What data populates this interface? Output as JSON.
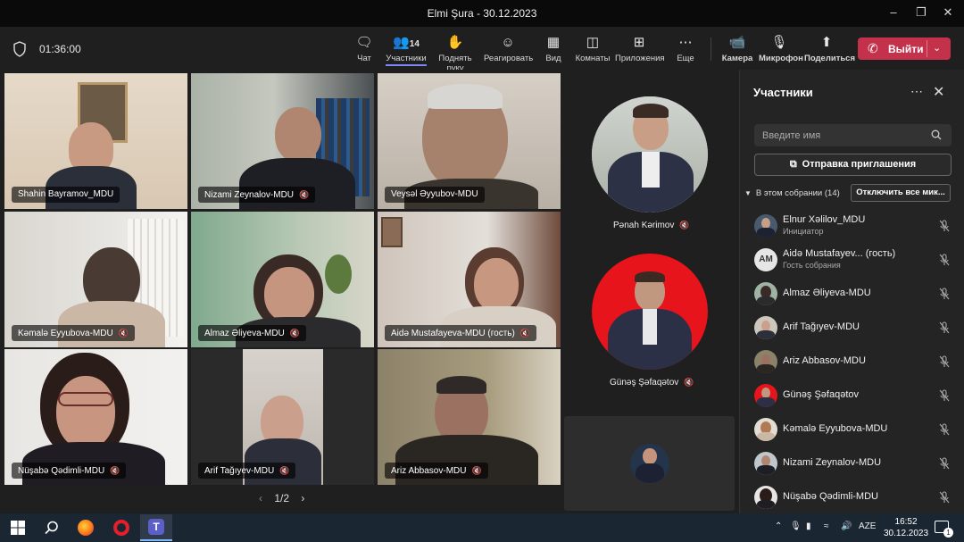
{
  "window": {
    "title": "Elmi Şura - 30.12.2023"
  },
  "meeting": {
    "timer": "01:36:00"
  },
  "toolbar": {
    "chat": "Чат",
    "participants": "Участники",
    "participants_count": "14",
    "raise_hand": "Поднять руку",
    "react": "Реагировать",
    "view": "Вид",
    "rooms": "Комнаты",
    "apps": "Приложения",
    "more": "Еще",
    "camera": "Камера",
    "mic": "Микрофон",
    "share": "Поделиться",
    "leave": "Выйти"
  },
  "grid": {
    "tiles": [
      {
        "name": "Shahin Bayramov_MDU",
        "muted": false
      },
      {
        "name": "Nizami Zeynalov-MDU",
        "muted": true
      },
      {
        "name": "Veysəl Əyyubov-MDU",
        "muted": false
      },
      {
        "name": "Kəmalə Eyyubova-MDU",
        "muted": true
      },
      {
        "name": "Almaz Əliyeva-MDU",
        "muted": true
      },
      {
        "name": "Aidə Mustafayeva-MDU (гость)",
        "muted": true
      },
      {
        "name": "Nüşabə Qədimli-MDU",
        "muted": true
      },
      {
        "name": "Arif Tağıyev-MDU",
        "muted": true
      },
      {
        "name": "Ariz Abbasov-MDU",
        "muted": true
      }
    ],
    "pager": "1/2"
  },
  "side_tiles": [
    {
      "name": "Pənah Kərimov"
    },
    {
      "name": "Günəş Şəfaqətov"
    }
  ],
  "panel": {
    "title": "Участники",
    "search_placeholder": "Введите имя",
    "invite": "Отправка приглашения",
    "section": "В этом собрании (14)",
    "mute_all": "Отключить все мик...",
    "people": [
      {
        "name": "Elnur Xəlilov_MDU",
        "sub": "Инициатор"
      },
      {
        "name": "Aidə Mustafayev... (гость)",
        "sub": "Гость собрания",
        "initials": "AM"
      },
      {
        "name": "Almaz Əliyeva-MDU"
      },
      {
        "name": "Arif Tağıyev-MDU"
      },
      {
        "name": "Ariz Abbasov-MDU"
      },
      {
        "name": "Günəş Şəfaqətov"
      },
      {
        "name": "Kəmalə Eyyubova-MDU"
      },
      {
        "name": "Nizami Zeynalov-MDU"
      },
      {
        "name": "Nüşabə Qədimli-MDU"
      }
    ]
  },
  "taskbar": {
    "lang": "AZE",
    "time": "16:52",
    "date": "30.12.2023",
    "notifications": "1"
  },
  "colors": {
    "accent": "#7f85f5",
    "leave": "#c4314b",
    "taskbar": "#1b2633"
  }
}
